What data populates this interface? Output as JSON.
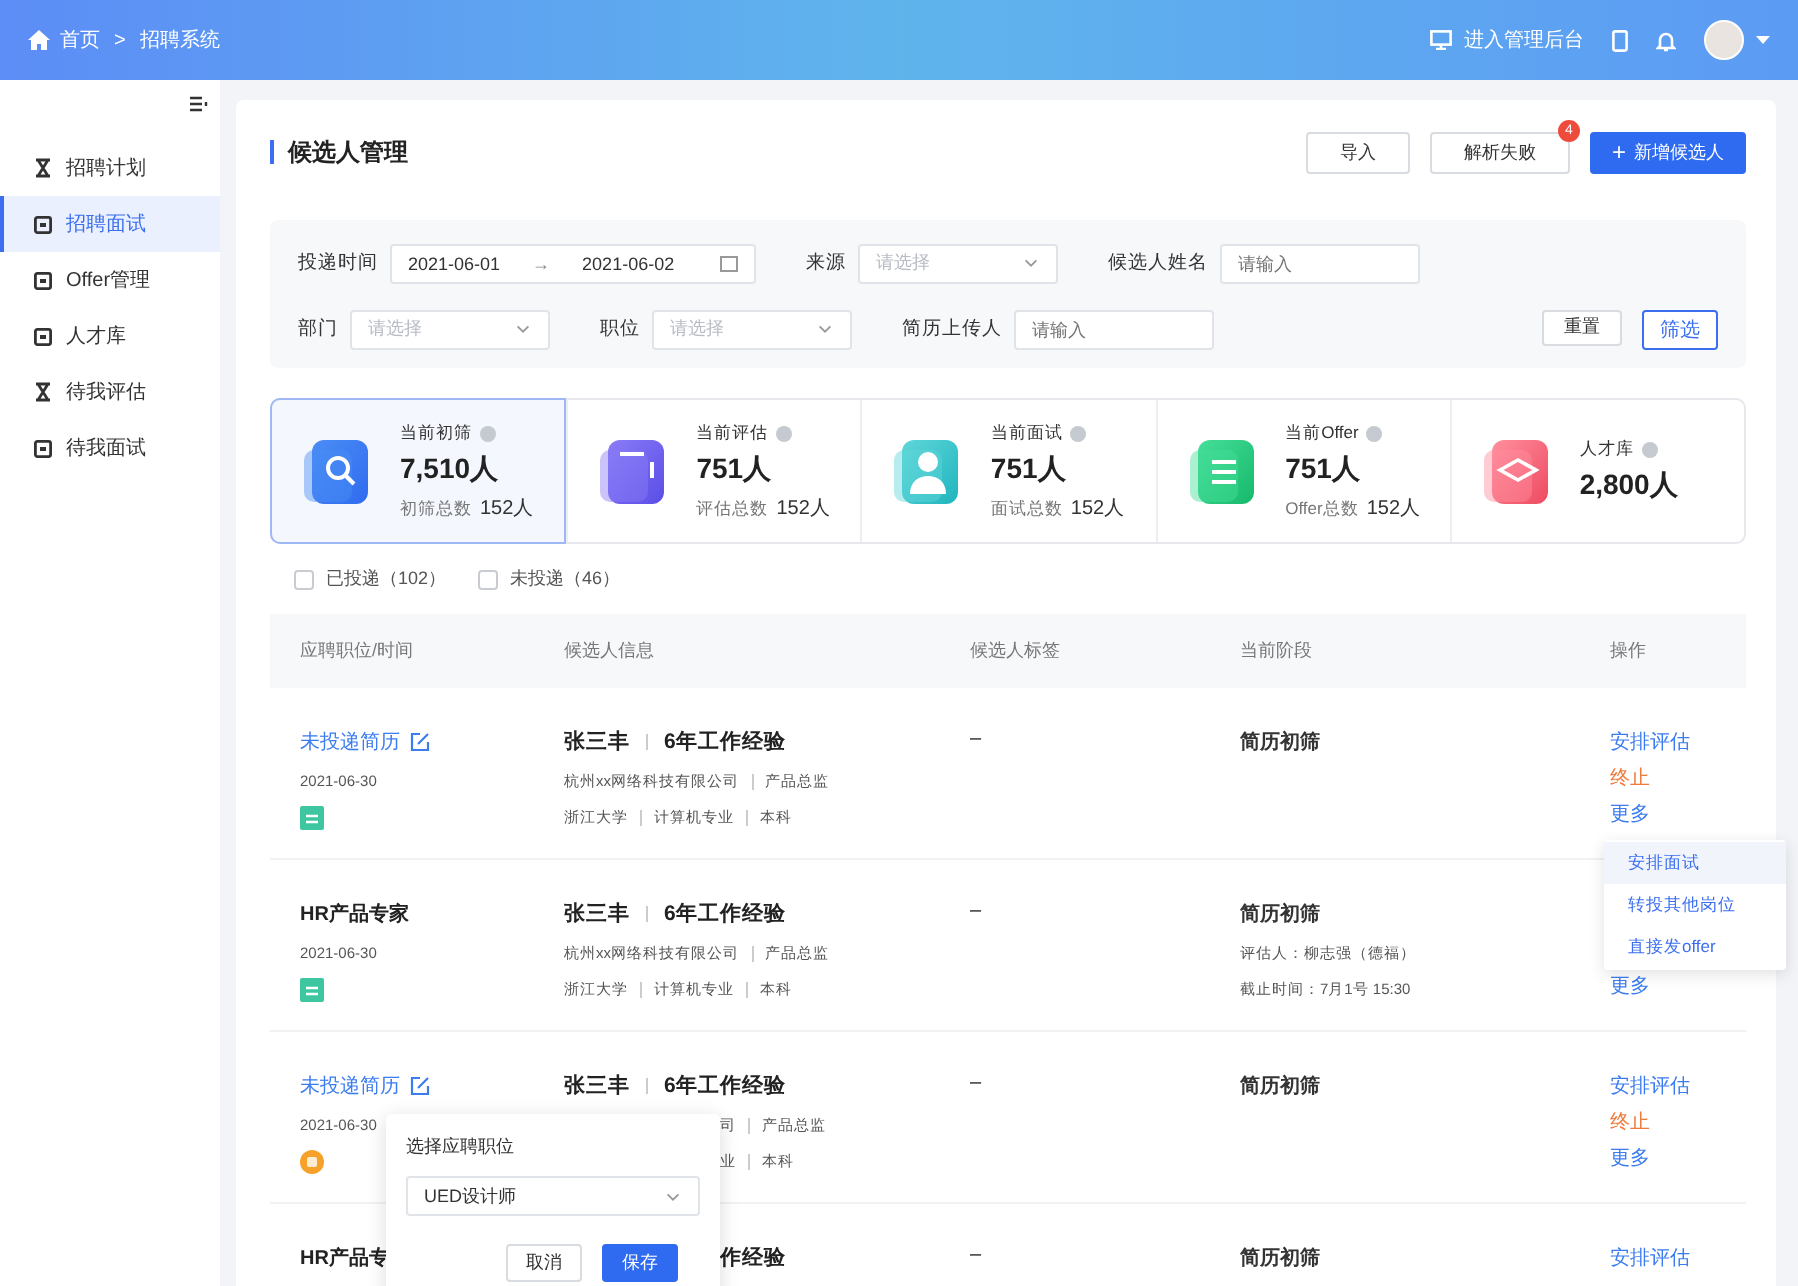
{
  "header": {
    "breadcrumb": [
      "首页",
      "招聘系统"
    ],
    "separator": ">",
    "admin_link": "进入管理后台"
  },
  "sidebar": {
    "items": [
      {
        "label": "招聘计划",
        "selected": false
      },
      {
        "label": "招聘面试",
        "selected": true
      },
      {
        "label": "Offer管理",
        "selected": false
      },
      {
        "label": "人才库",
        "selected": false
      },
      {
        "label": "待我评估",
        "selected": false
      },
      {
        "label": "待我面试",
        "selected": false
      }
    ]
  },
  "page": {
    "title": "候选人管理",
    "buttons": [
      {
        "label": "导入",
        "kind": "plain"
      },
      {
        "label": "解析失败",
        "kind": "plain",
        "badge": "4"
      },
      {
        "label": "新增候选人",
        "kind": "primary",
        "icon": "+"
      }
    ]
  },
  "filters": {
    "row1": [
      {
        "label": "投递时间",
        "kind": "daterange",
        "start": "2021-06-01",
        "end": "2021-06-02",
        "arrow": "→"
      },
      {
        "label": "来源",
        "kind": "select",
        "placeholder": "请选择"
      },
      {
        "label": "候选人姓名",
        "kind": "input",
        "placeholder": "请输入"
      }
    ],
    "row2": [
      {
        "label": "部门",
        "kind": "select",
        "placeholder": "请选择"
      },
      {
        "label": "职位",
        "kind": "select",
        "placeholder": "请选择"
      },
      {
        "label": "简历上传人",
        "kind": "input",
        "placeholder": "请输入"
      }
    ],
    "buttons": [
      {
        "label": "重置",
        "kind": "plain"
      },
      {
        "label": "筛选",
        "kind": "outline"
      }
    ]
  },
  "stats": [
    {
      "label": "当前初筛",
      "value": "7,510人",
      "total_label": "初筛总数",
      "total_value": "152人",
      "selected": true
    },
    {
      "label": "当前评估",
      "value": "751人",
      "total_label": "评估总数",
      "total_value": "152人",
      "selected": false
    },
    {
      "label": "当前面试",
      "value": "751人",
      "total_label": "面试总数",
      "total_value": "152人",
      "selected": false
    },
    {
      "label": "当前Offer",
      "value": "751人",
      "total_label": "Offer总数",
      "total_value": "152人",
      "selected": false
    },
    {
      "label": "人才库",
      "value": "2,800人",
      "selected": false
    }
  ],
  "checkboxes": [
    {
      "label": "已投递（102）",
      "checked": false
    },
    {
      "label": "未投递（46）",
      "checked": false
    }
  ],
  "table": {
    "columns": [
      "应聘职位/时间",
      "候选人信息",
      "候选人标签",
      "当前阶段",
      "操作"
    ],
    "rows": [
      {
        "title": "未投递简历",
        "kind": "link",
        "date": "2021-06-30",
        "badge": {
          "kind": "square",
          "color": "#3ec6a1"
        },
        "headline": {
          "covered": false,
          "parts": [
            "张三丰",
            "6年工作经验"
          ]
        },
        "lines": [
          {
            "covered": false,
            "parts": [
              "杭州xx网络科技有限公司",
              "产品总监"
            ]
          },
          {
            "covered": false,
            "parts": [
              "浙江大学",
              "计算机专业",
              "本科"
            ]
          }
        ],
        "tag": "–",
        "stage": "简历初筛",
        "notes": [],
        "actions": [
          {
            "label": "安排评估",
            "kind": "arrange"
          },
          {
            "label": "终止",
            "kind": "stop"
          },
          {
            "label": "更多",
            "kind": "more"
          }
        ]
      },
      {
        "title": "HR产品专家",
        "kind": "plain",
        "date": "2021-06-30",
        "badge": {
          "kind": "square",
          "color": "#3ec6a1"
        },
        "headline": {
          "covered": false,
          "parts": [
            "张三丰",
            "6年工作经验"
          ]
        },
        "lines": [
          {
            "covered": false,
            "parts": [
              "杭州xx网络科技有限公司",
              "产品总监"
            ]
          },
          {
            "covered": false,
            "parts": [
              "浙江大学",
              "计算机专业",
              "本科"
            ]
          }
        ],
        "tag": "–",
        "stage": "简历初筛",
        "notes": [
          "评估人：柳志强（德福）",
          "截止时间：7月1号  15:30"
        ],
        "actions": [
          {
            "label": "更多",
            "kind": "more"
          }
        ]
      },
      {
        "title": "未投递简历",
        "kind": "link",
        "date": "2021-06-30",
        "badge": {
          "kind": "circle",
          "color": "#f5a12a"
        },
        "headline": {
          "covered": false,
          "parts": [
            "张三丰",
            "6年工作经验"
          ]
        },
        "lines": [
          {
            "covered": true,
            "parts": [
              "司",
              "产品总监"
            ]
          },
          {
            "covered": true,
            "parts": [
              "业",
              "本科"
            ]
          }
        ],
        "tag": "–",
        "stage": "简历初筛",
        "notes": [],
        "actions": [
          {
            "label": "安排评估",
            "kind": "arrange"
          },
          {
            "label": "终止",
            "kind": "stop"
          },
          {
            "label": "更多",
            "kind": "more"
          }
        ]
      },
      {
        "title": "HR产品专",
        "kind": "plain",
        "headline": {
          "covered": true,
          "parts": [
            "作经验"
          ]
        },
        "lines": [],
        "tag": "–",
        "stage": "简历初筛",
        "notes": [],
        "actions": [
          {
            "label": "安排评估",
            "kind": "arrange"
          }
        ]
      }
    ]
  },
  "more_menu": {
    "items": [
      {
        "label": "安排面试",
        "selected": true
      },
      {
        "label": "转投其他岗位",
        "selected": false
      },
      {
        "label": "直接发offer",
        "selected": false
      }
    ]
  },
  "position_popup": {
    "label": "选择应聘职位",
    "value": "UED设计师",
    "buttons": [
      {
        "label": "取消",
        "kind": "plain"
      },
      {
        "label": "保存",
        "kind": "primary"
      }
    ]
  }
}
